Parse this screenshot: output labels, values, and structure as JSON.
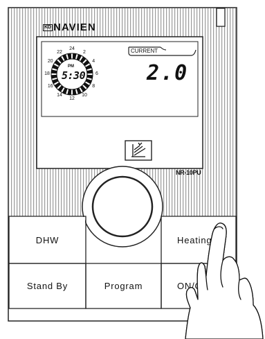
{
  "brand": {
    "prefix": "KD",
    "name": "NAVIEN"
  },
  "model": "NR-10PU",
  "display": {
    "current_label": "CURRENT",
    "period": "PM",
    "time": "5:30",
    "value": "2.0",
    "clock_hours": [
      "24",
      "2",
      "4",
      "6",
      "8",
      "10",
      "12",
      "14",
      "16",
      "18",
      "20",
      "22"
    ],
    "mode_icon": "heating-mode-icon"
  },
  "buttons": {
    "dhw": "DHW",
    "heating": "Heating",
    "standby": "Stand By",
    "program": "Program",
    "onoff": "ON/OFF"
  },
  "dial": {
    "icon": "rotary-dial"
  },
  "hand": {
    "icon": "pointing-hand-icon"
  }
}
